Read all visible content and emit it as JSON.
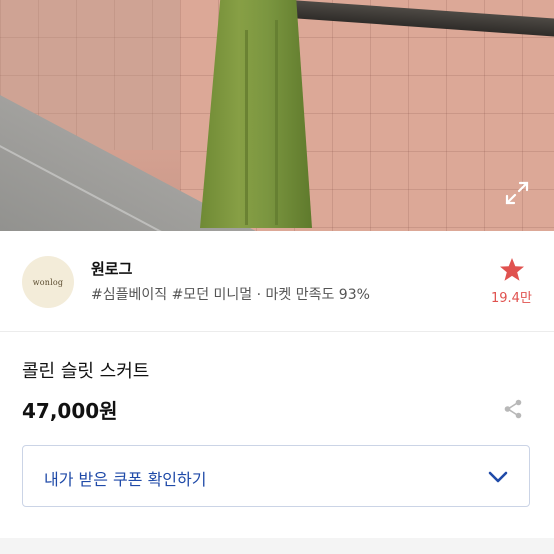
{
  "hero": {
    "expand_icon": "expand-icon"
  },
  "shop": {
    "logo_text": "wonlog",
    "name": "원로그",
    "tags": "#심플베이직 #모던 미니멀 · 마켓 만족도 93%",
    "like_icon": "star-icon",
    "like_count": "19.4만",
    "like_color": "#e0524f"
  },
  "product": {
    "name": "콜린 슬릿 스커트",
    "price": "47,000원",
    "share_icon": "share-icon"
  },
  "coupon": {
    "label": "내가 받은 쿠폰 확인하기",
    "icon": "chevron-down-icon",
    "color": "#1f4aa8"
  }
}
